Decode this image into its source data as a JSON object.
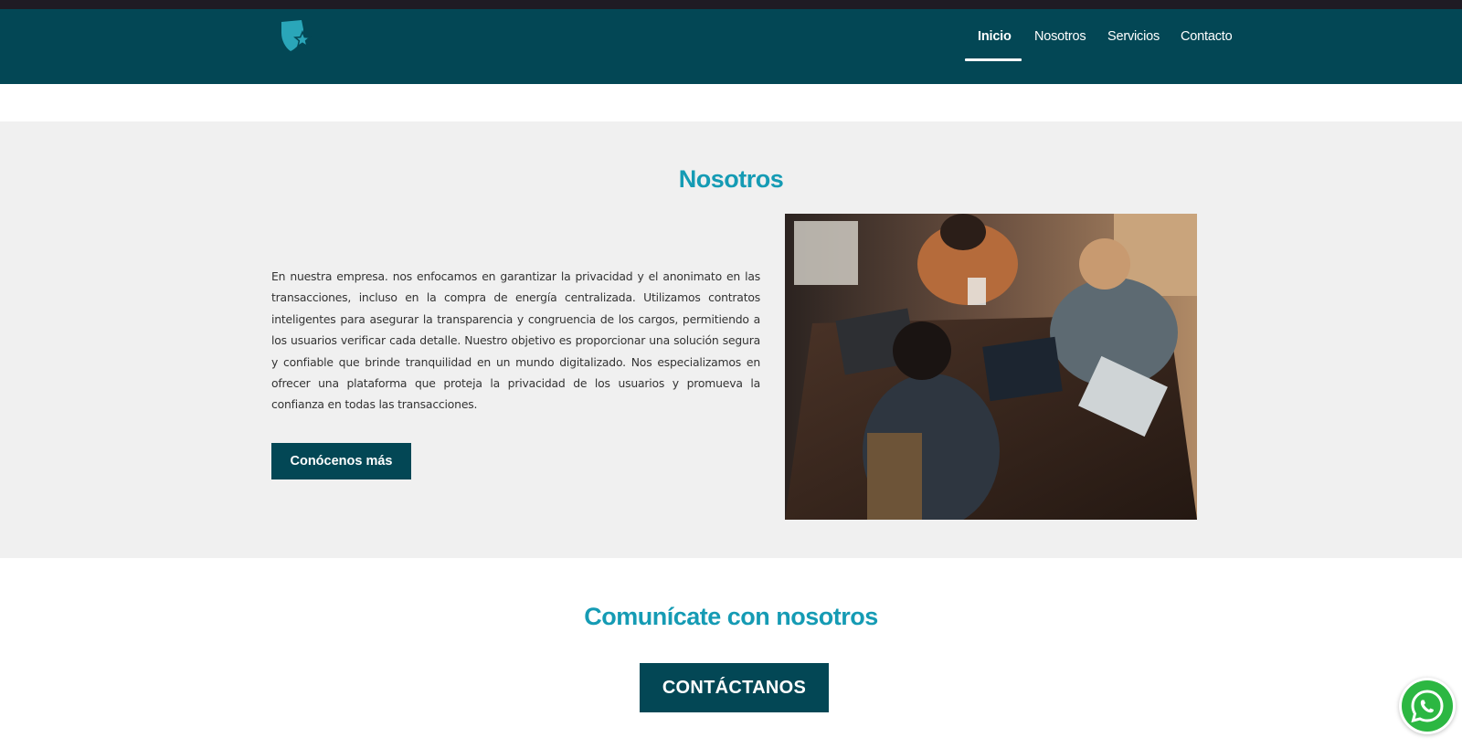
{
  "colors": {
    "nav_bg": "#034755",
    "accent_title": "#159bb4",
    "section_bg": "#f0f0f0",
    "button_bg": "#034755",
    "whatsapp_green": "#2cb742"
  },
  "nav": {
    "logo_icon": "shield-star-icon",
    "items": [
      {
        "label": "Inicio",
        "active": true
      },
      {
        "label": "Nosotros",
        "active": false
      },
      {
        "label": "Servicios",
        "active": false
      },
      {
        "label": "Contacto",
        "active": false
      }
    ]
  },
  "about": {
    "title": "Nosotros",
    "text": "En nuestra empresa. nos enfocamos en garantizar la privacidad y el anonimato en las transacciones, incluso en la compra de energía centralizada. Utilizamos contratos inteligentes para asegurar la transparencia y congruencia de los cargos, permitiendo a los usuarios verificar cada detalle. Nuestro objetivo es proporcionar una solución segura y confiable que brinde tranquilidad en un mundo digitalizado. Nos especializamos en ofrecer una plataforma que proteja la privacidad de los usuarios y promueva la confianza en todas las transacciones.",
    "button_label": "Conócenos más"
  },
  "contact": {
    "title": "Comunícate con nosotros",
    "button_label": "CONTÁCTANOS"
  },
  "floating": {
    "whatsapp_icon": "whatsapp-icon"
  }
}
